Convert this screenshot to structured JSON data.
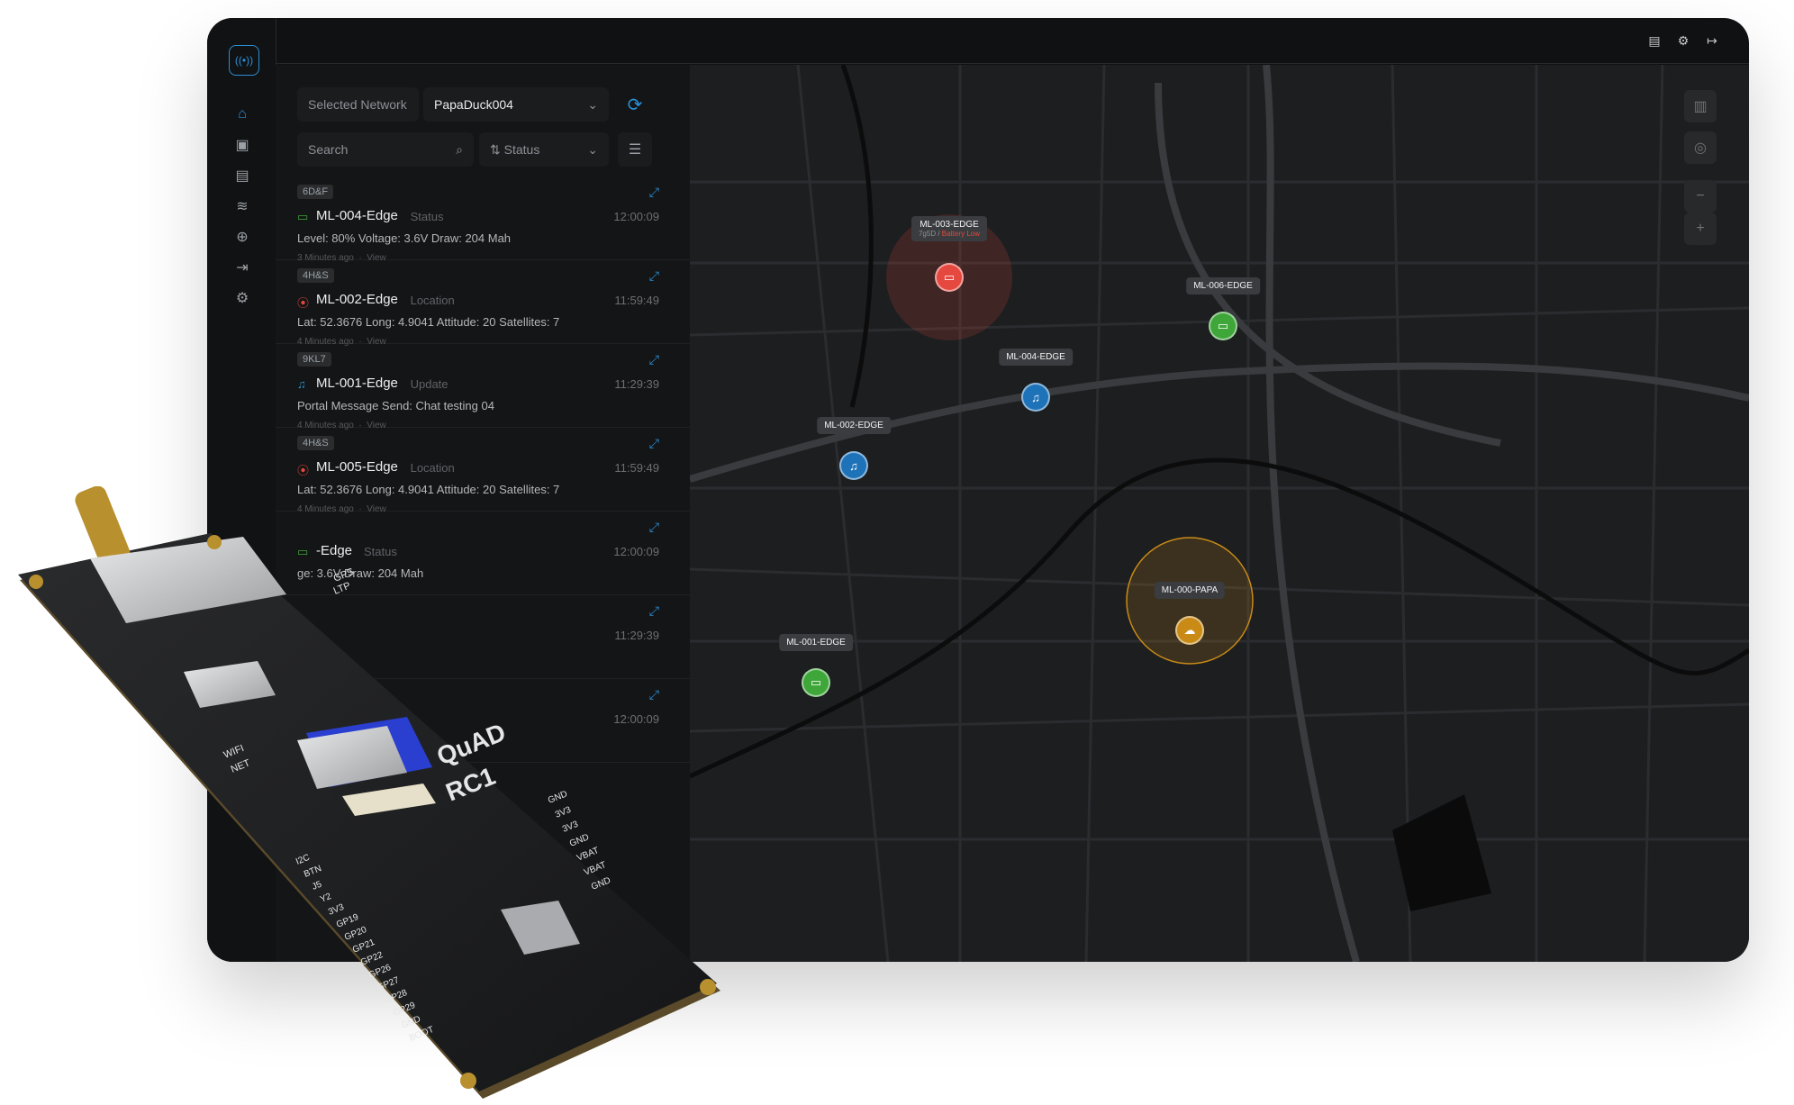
{
  "sidebar": {
    "items": [
      "home-icon",
      "chip-icon",
      "map-icon",
      "wifi-icon",
      "add-circle-icon",
      "export-icon",
      "gear-icon"
    ],
    "logout": "logout-icon"
  },
  "topbar": {
    "icons": [
      "document-icon",
      "gear-icon",
      "logout-icon"
    ]
  },
  "network": {
    "label": "Selected Network",
    "value": "PapaDuck004"
  },
  "search": {
    "placeholder": "Search",
    "sort_label": "Status"
  },
  "messages": [
    {
      "badge": "6D&F",
      "icon": "battery",
      "name": "ML-004-Edge",
      "type": "Status",
      "time": "12:00:09",
      "detail": "Level: 80%  Voltage: 3.6V  Draw: 204 Mah",
      "ago": "3 Minutes ago",
      "view": "View"
    },
    {
      "badge": "4H&S",
      "icon": "location",
      "name": "ML-002-Edge",
      "type": "Location",
      "time": "11:59:49",
      "detail": "Lat: 52.3676 Long: 4.9041 Attitude: 20 Satellites: 7",
      "ago": "4 Minutes ago",
      "view": "View"
    },
    {
      "badge": "9KL7",
      "icon": "bell",
      "name": "ML-001-Edge",
      "type": "Update",
      "time": "11:29:39",
      "detail": "Portal Message Send: Chat testing 04",
      "ago": "4 Minutes ago",
      "view": "View"
    },
    {
      "badge": "4H&S",
      "icon": "location",
      "name": "ML-005-Edge",
      "type": "Location",
      "time": "11:59:49",
      "detail": "Lat: 52.3676 Long: 4.9041 Attitude: 20 Satellites: 7",
      "ago": "4 Minutes ago",
      "view": "View"
    },
    {
      "badge": "",
      "icon": "battery",
      "name": "-Edge",
      "type": "Status",
      "time": "12:00:09",
      "detail": "ge: 3.6V  Draw: 204 Mah",
      "ago": "",
      "view": ""
    },
    {
      "badge": "",
      "icon": "",
      "name": "",
      "type": "",
      "time": "11:29:39",
      "detail": "",
      "ago": "",
      "view": ""
    },
    {
      "badge": "",
      "icon": "",
      "name": "",
      "type": "",
      "time": "12:00:09",
      "detail": "",
      "ago": "",
      "view": ""
    }
  ],
  "map": {
    "controls": [
      "map-layer-icon",
      "compass-icon",
      "zoom-out-icon",
      "zoom-in-icon"
    ],
    "pins": [
      {
        "label": "ML-003-EDGE",
        "sub_id": "7g5D",
        "sub_alert": "Battery Low",
        "color": "#e5483e",
        "icon": "battery-icon"
      },
      {
        "label": "ML-006-EDGE",
        "color": "#3fa63a",
        "icon": "battery-icon"
      },
      {
        "label": "ML-004-EDGE",
        "color": "#1e72b8",
        "icon": "bell-icon"
      },
      {
        "label": "ML-002-EDGE",
        "color": "#1e72b8",
        "icon": "bell-icon"
      },
      {
        "label": "ML-000-PAPA",
        "color": "#c98a16",
        "icon": "cloud-upload-icon"
      },
      {
        "label": "ML-001-EDGE",
        "color": "#3fa63a",
        "icon": "battery-icon"
      }
    ]
  },
  "board": {
    "brand": "QuAD",
    "model": "RC1",
    "silk_left": [
      "WIFI",
      "NET"
    ],
    "silk_right": [
      "GND",
      "3V3",
      "3V3",
      "GND",
      "VBAT",
      "VBAT",
      "GND"
    ],
    "silk_bottom": [
      "I2C",
      "BTN",
      "J5",
      "Y2",
      "3V3",
      "GP19",
      "GP20",
      "GP21",
      "GP22",
      "GP26",
      "GP27",
      "GP28",
      "GP29",
      "GND",
      "BOOT"
    ],
    "silk_top": [
      "GPS",
      "LTP"
    ]
  },
  "colors": {
    "accent": "#2b8fd6",
    "red": "#e5483e",
    "green": "#3fa63a",
    "amber": "#c98a16"
  }
}
